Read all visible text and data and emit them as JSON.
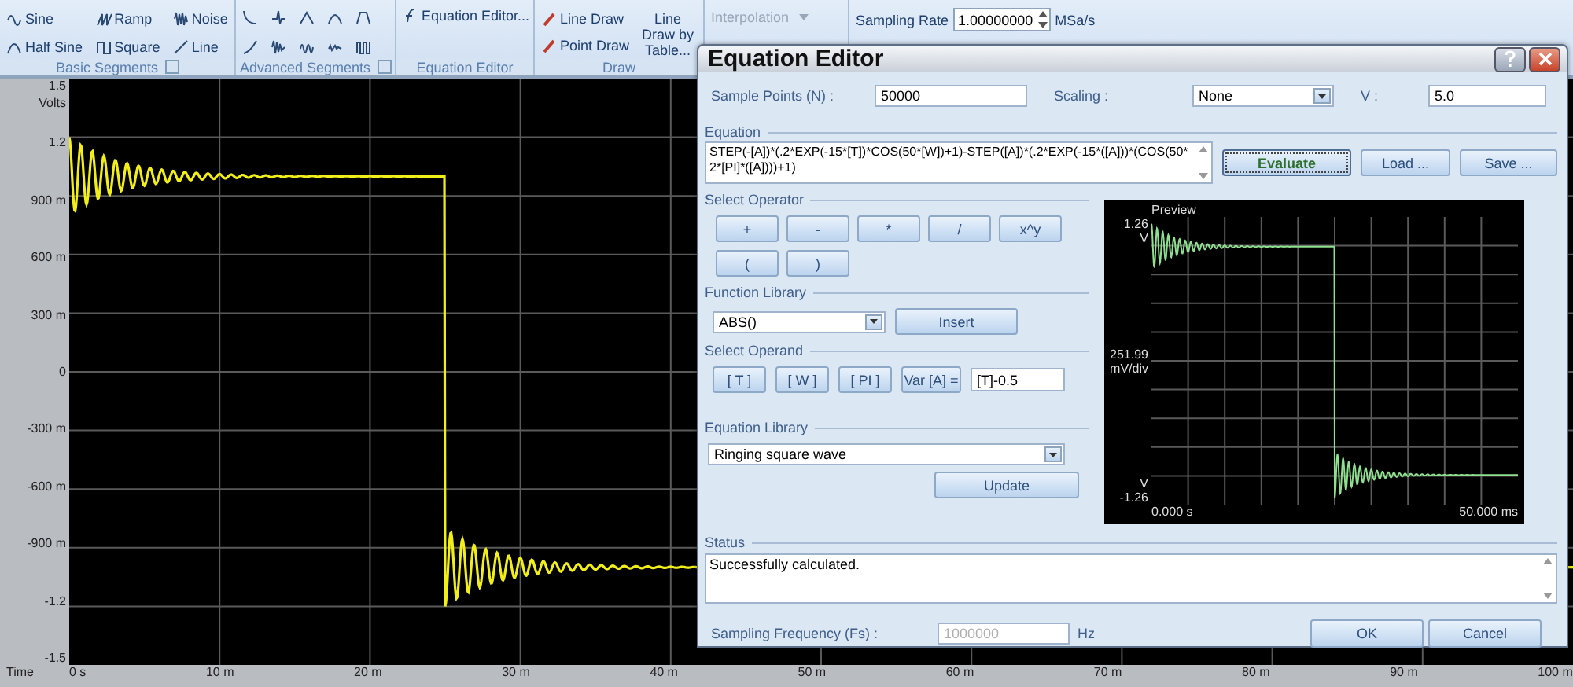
{
  "ribbon": {
    "basic_segments": {
      "label": "Basic Segments",
      "items": [
        {
          "label": "Sine"
        },
        {
          "label": "Ramp"
        },
        {
          "label": "Noise"
        },
        {
          "label": "Half Sine"
        },
        {
          "label": "Square"
        },
        {
          "label": "Line"
        }
      ]
    },
    "advanced_segments": {
      "label": "Advanced Segments"
    },
    "equation_group": {
      "button": "Equation Editor...",
      "label": "Equation Editor"
    },
    "draw_group": {
      "items": [
        "Line Draw",
        "Point Draw"
      ],
      "table_button": "Line Draw by Table...",
      "label": "Draw"
    },
    "interpolation": {
      "label": "Interpolation",
      "disabled": true
    },
    "sampling_rate": {
      "label": "Sampling Rate",
      "value": "1.00000000",
      "unit": "MSa/s"
    }
  },
  "plot": {
    "y_unit": "Volts",
    "y_ticks": [
      "1.5",
      "1.2",
      "900 m",
      "600 m",
      "300 m",
      "0",
      "-300 m",
      "-600 m",
      "-900 m",
      "-1.2",
      "-1.5"
    ],
    "x_title": "Time",
    "x_ticks": [
      "0 s",
      "10 m",
      "20 m",
      "30 m",
      "40 m",
      "50 m",
      "60 m",
      "70 m",
      "80 m",
      "90 m",
      "100 m"
    ]
  },
  "dialog": {
    "title": "Equation Editor",
    "sample_points": {
      "label": "Sample Points (N) :",
      "value": "50000"
    },
    "scaling": {
      "label": "Scaling :",
      "value": "None"
    },
    "v": {
      "label": "V :",
      "value": "5.0"
    },
    "equation": {
      "label": "Equation",
      "value": "STEP(-[A])*(.2*EXP(-15*[T])*COS(50*[W])+1)-STEP([A])*(.2*EXP(-15*([A]))*(COS(50*2*[PI]*([A])))+1)"
    },
    "evaluate": "Evaluate",
    "load": "Load ...",
    "save": "Save ...",
    "operators": {
      "label": "Select Operator",
      "items": [
        "+",
        "-",
        "*",
        "/",
        "x^y",
        "(",
        ")"
      ]
    },
    "function_library": {
      "label": "Function Library",
      "value": "ABS()",
      "button": "Insert"
    },
    "operand": {
      "label": "Select Operand",
      "items": [
        "[ T ]",
        "[ W ]",
        "[ PI ]"
      ],
      "var_label": "Var [A] =",
      "var_value": "[T]-0.5"
    },
    "equation_library": {
      "label": "Equation Library",
      "value": "Ringing square wave",
      "button": "Update"
    },
    "preview": {
      "title": "Preview",
      "top_value": "1.26",
      "top_unit": "V",
      "mid_value": "251.99",
      "mid_unit": "mV/div",
      "bottom_unit": "V",
      "bottom_value": "-1.26",
      "x_start": "0.000 s",
      "x_end": "50.000 ms"
    },
    "status": {
      "label": "Status",
      "value": "Successfully calculated."
    },
    "sampling_frequency": {
      "label": "Sampling Frequency (Fs) :",
      "value": "1000000",
      "unit": "Hz",
      "disabled": true
    },
    "ok": "OK",
    "cancel": "Cancel"
  }
}
